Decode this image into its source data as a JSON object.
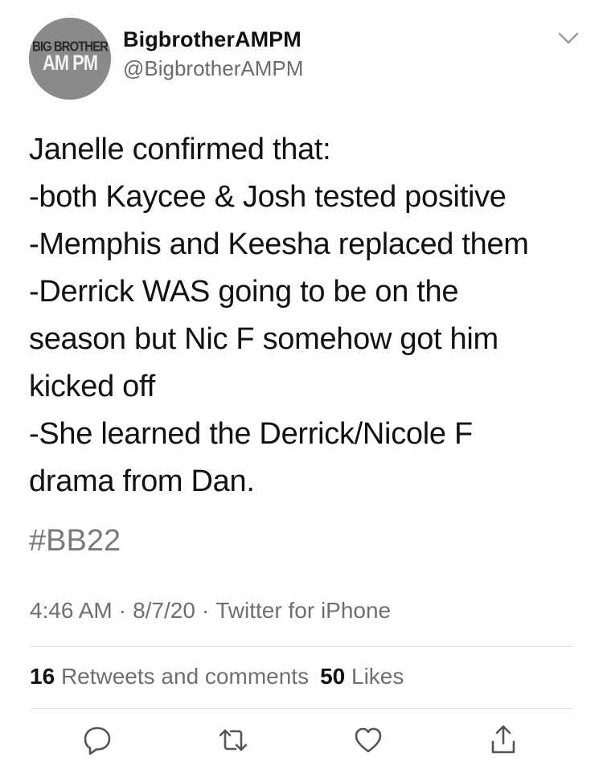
{
  "author": {
    "avatar_text_top": "BIG BROTHER",
    "avatar_text_bottom": "AM PM",
    "display_name": "BigbrotherAMPM",
    "handle": "@BigbrotherAMPM"
  },
  "tweet": {
    "lines": [
      "Janelle confirmed that:",
      "-both Kaycee & Josh tested positive",
      "-Memphis and Keesha replaced them",
      "-Derrick WAS going to be on the",
      "season but Nic F somehow got him",
      "kicked off",
      "-She learned the Derrick/Nicole F",
      "drama from Dan."
    ],
    "hashtag": "#BB22",
    "time": "4:46 AM",
    "date": "8/7/20",
    "source": "Twitter for iPhone",
    "separator": "·"
  },
  "stats": {
    "retweets_count": "16",
    "retweets_label": "Retweets and comments",
    "likes_count": "50",
    "likes_label": "Likes"
  },
  "icons": {
    "menu": "chevron-down-icon",
    "reply": "reply-icon",
    "retweet": "retweet-icon",
    "like": "heart-icon",
    "share": "share-icon"
  },
  "colors": {
    "text": "#111111",
    "secondary": "#6f6f6f",
    "divider": "#e2e2e2",
    "avatar_bg": "#8a8a8a"
  }
}
